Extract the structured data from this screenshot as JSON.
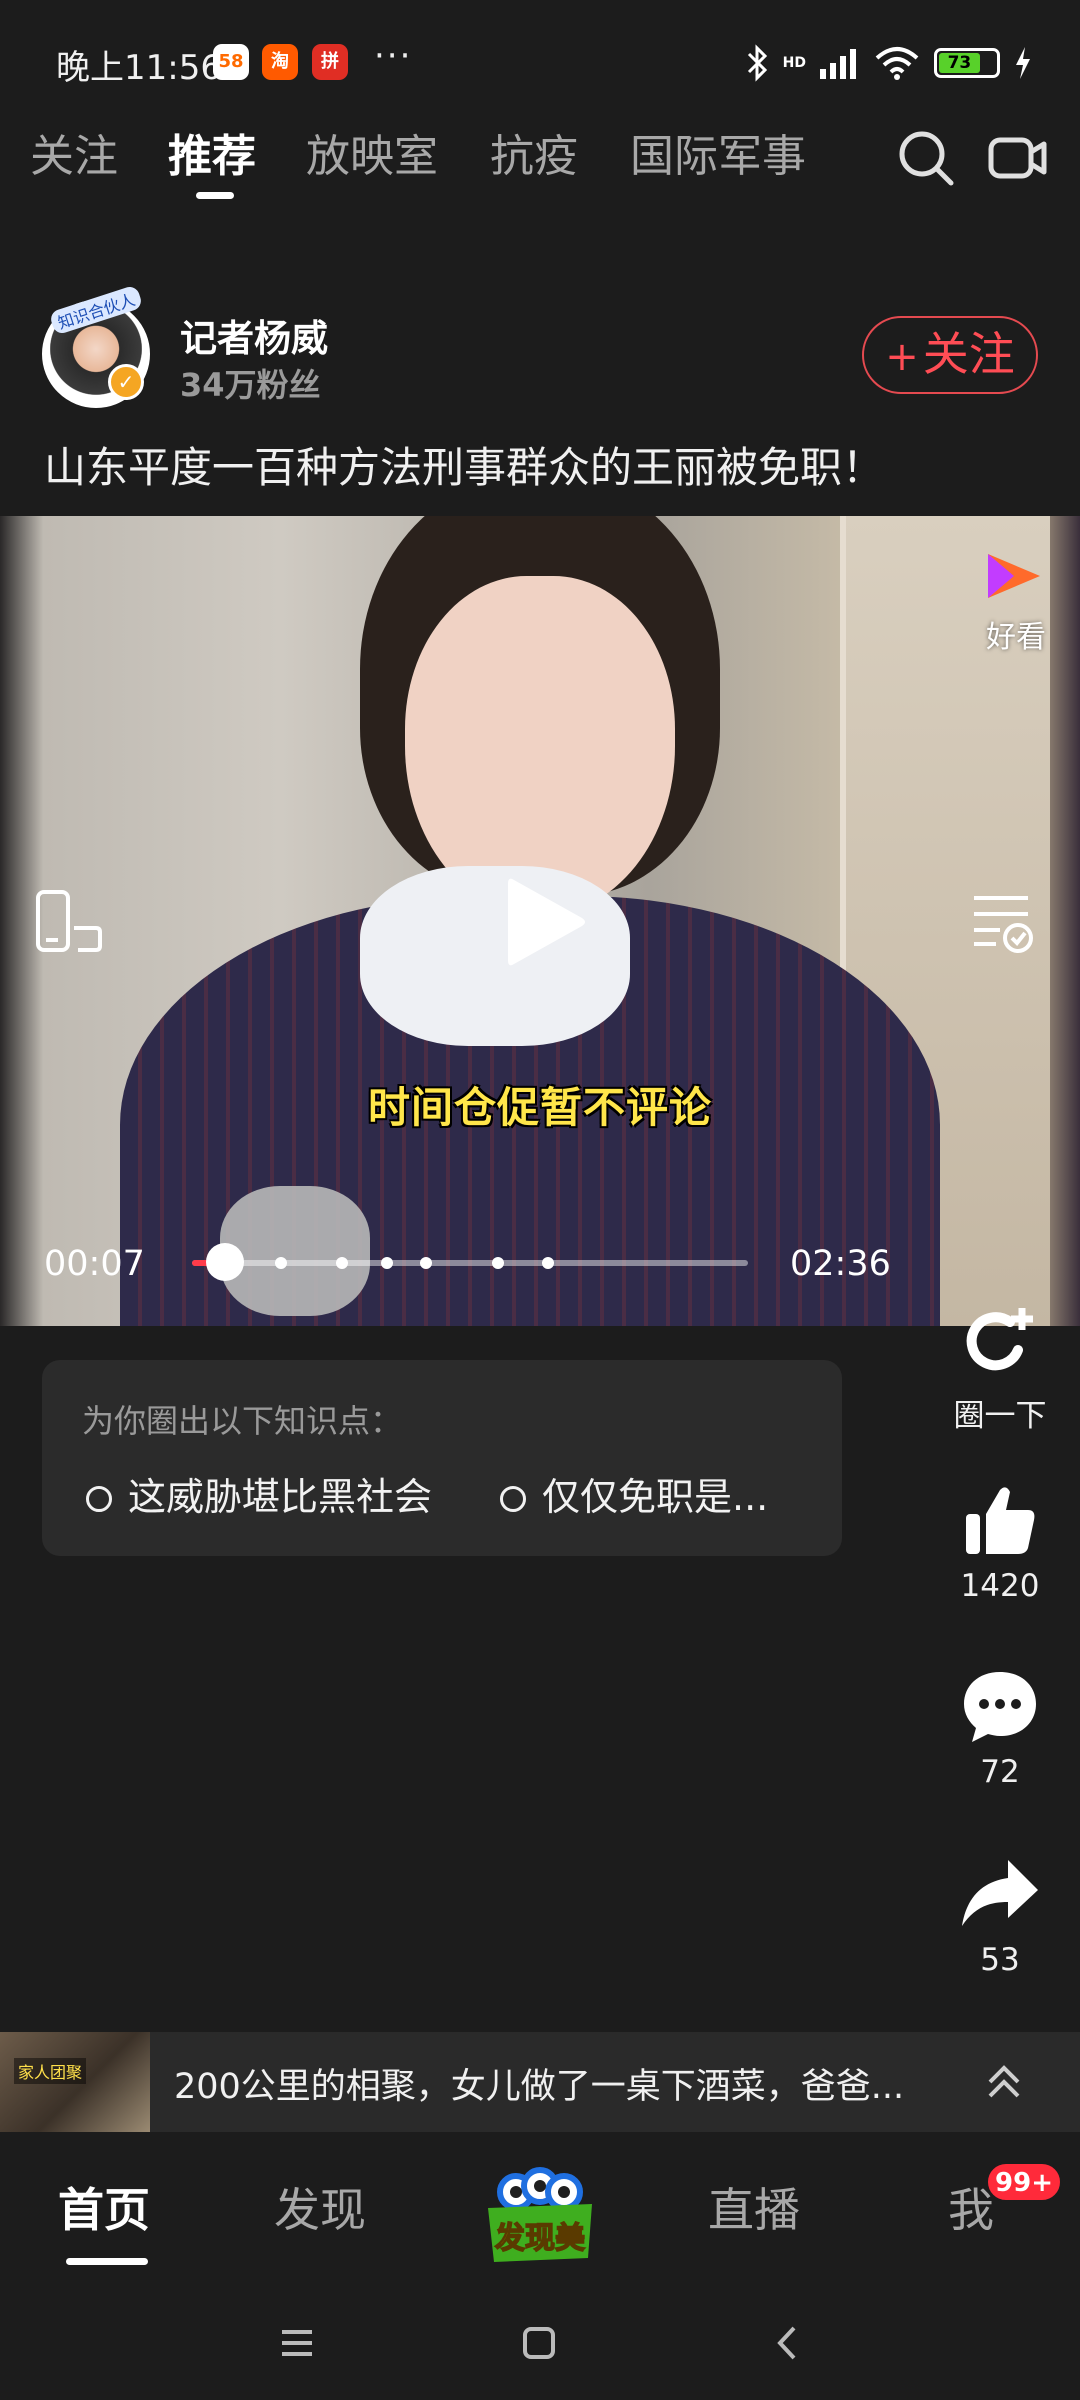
{
  "status_bar": {
    "time": "晚上11:56",
    "app_icons": [
      "58",
      "淘",
      "拼"
    ],
    "more": "···",
    "battery": "73",
    "signal_tag": "HD"
  },
  "top_nav": {
    "tabs": [
      {
        "label": "关注",
        "active": false
      },
      {
        "label": "推荐",
        "active": true
      },
      {
        "label": "放映室",
        "active": false
      },
      {
        "label": "抗疫",
        "active": false
      },
      {
        "label": "国际军事",
        "active": false
      }
    ],
    "icons": [
      "search-icon",
      "video-camera-icon"
    ]
  },
  "author": {
    "name": "记者杨威",
    "fans": "34万粉丝",
    "avatar_tag": "知识合伙人",
    "follow_label": "关注"
  },
  "video": {
    "title": "山东平度一百种方法刑事群众的王丽被免职！",
    "subtitle": "时间仓促暂不评论",
    "current_time": "00:07",
    "total_time": "02:36",
    "progress": 0.045,
    "chapter_marks": [
      0.08,
      0.16,
      0.27,
      0.35,
      0.42,
      0.55,
      0.64
    ],
    "brand_label": "好看"
  },
  "knowledge": {
    "title": "为你圈出以下知识点：",
    "items": [
      "这威胁堪比黑社会",
      "仅仅免职是..."
    ]
  },
  "actions": {
    "circle_label": "圈一下",
    "likes": "1420",
    "comments": "72",
    "shares": "53"
  },
  "related": {
    "thumb_tag": "家人团聚",
    "text": "200公里的相聚，女儿做了一桌下酒菜，爸爸..."
  },
  "bottom_nav": {
    "items": [
      {
        "label": "首页",
        "active": true
      },
      {
        "label": "发现",
        "active": false
      },
      {
        "label": "直播",
        "active": false
      },
      {
        "label": "我",
        "active": false
      }
    ],
    "center_logo": "发现美",
    "badge": "99+"
  },
  "colors": {
    "background": "#1c1c1c",
    "accent_red": "#ff4d55",
    "subtitle_yellow": "#ffe64a"
  }
}
